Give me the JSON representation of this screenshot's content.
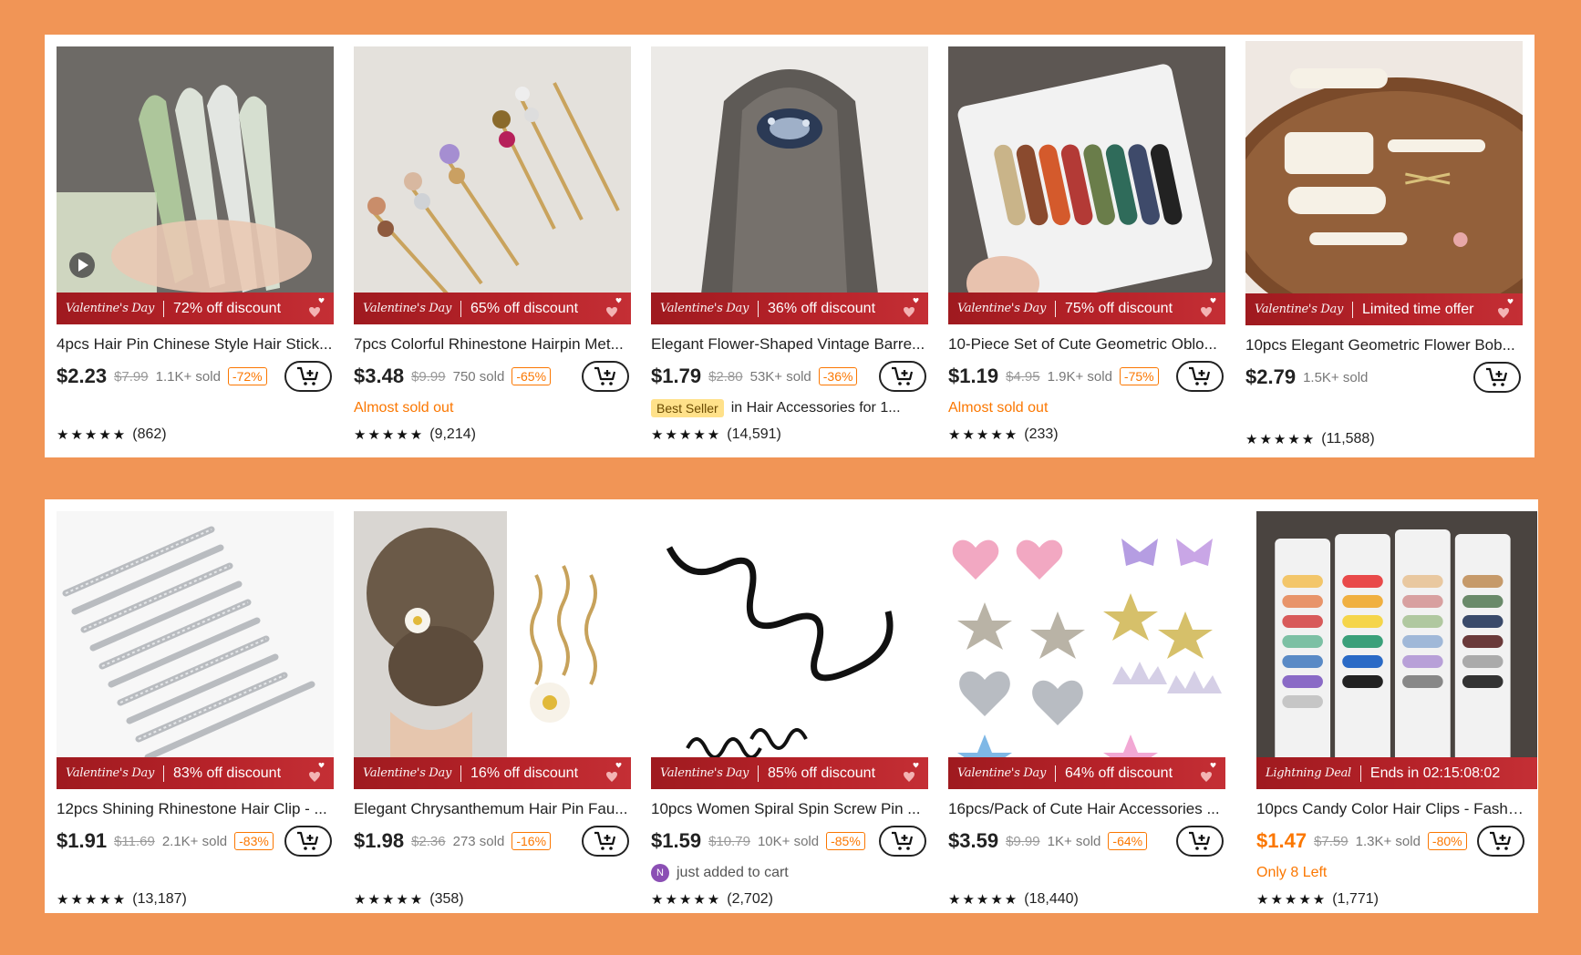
{
  "banner_brand": "Valentine's Day",
  "rows": [
    [
      {
        "title": "4pcs Hair Pin Chinese Style Hair Stick...",
        "deal": "72% off discount",
        "price": "$2.23",
        "orig": "$7.99",
        "sold": "1.1K+ sold",
        "disc": "-72%",
        "extra": "",
        "reviews": "(862)",
        "stars": "★★★★★"
      },
      {
        "title": "7pcs Colorful Rhinestone Hairpin Met...",
        "deal": "65% off discount",
        "price": "$3.48",
        "orig": "$9.99",
        "sold": "750 sold",
        "disc": "-65%",
        "extra": "Almost sold out",
        "reviews": "(9,214)",
        "stars": "★★★★★"
      },
      {
        "title": "Elegant Flower-Shaped Vintage Barre...",
        "deal": "36% off discount",
        "price": "$1.79",
        "orig": "$2.80",
        "sold": "53K+ sold",
        "disc": "-36%",
        "badge": "Best Seller",
        "extra": "in Hair Accessories for 1...",
        "reviews": "(14,591)",
        "stars": "★★★★★"
      },
      {
        "title": "10-Piece Set of Cute Geometric Oblo...",
        "deal": "75% off discount",
        "price": "$1.19",
        "orig": "$4.95",
        "sold": "1.9K+ sold",
        "disc": "-75%",
        "extra": "Almost sold out",
        "reviews": "(233)",
        "stars": "★★★★★"
      },
      {
        "title": "10pcs Elegant Geometric Flower Bob...",
        "deal": "Limited time offer",
        "price": "$2.79",
        "orig": "",
        "sold": "1.5K+ sold",
        "disc": "",
        "extra": "",
        "reviews": "(11,588)",
        "stars": "★★★★★"
      }
    ],
    [
      {
        "title": "12pcs Shining Rhinestone Hair Clip - ...",
        "deal": "83% off discount",
        "price": "$1.91",
        "orig": "$11.69",
        "sold": "2.1K+ sold",
        "disc": "-83%",
        "extra": "",
        "reviews": "(13,187)",
        "stars": "★★★★★"
      },
      {
        "title": "Elegant Chrysanthemum Hair Pin Fau...",
        "deal": "16% off discount",
        "price": "$1.98",
        "orig": "$2.36",
        "sold": "273 sold",
        "disc": "-16%",
        "extra": "",
        "reviews": "(358)",
        "stars": "★★★★★"
      },
      {
        "title": "10pcs Women Spiral Spin Screw Pin ...",
        "deal": "85% off discount",
        "price": "$1.59",
        "orig": "$10.79",
        "sold": "10K+ sold",
        "disc": "-85%",
        "avatar": "N",
        "extra": "just added to cart",
        "reviews": "(2,702)",
        "stars": "★★★★★"
      },
      {
        "title": "16pcs/Pack of Cute Hair Accessories ...",
        "deal": "64% off discount",
        "price": "$3.59",
        "orig": "$9.99",
        "sold": "1K+ sold",
        "disc": "-64%",
        "extra": "",
        "reviews": "(18,440)",
        "stars": "★★★★★"
      },
      {
        "title": "10pcs Candy Color Hair Clips - Fashio...",
        "deal": "Ends in 02:15:08:02",
        "deal_brand": "Lightning Deal",
        "price": "$1.47",
        "orig": "$7.59",
        "sold": "1.3K+ sold",
        "disc": "-80%",
        "extra": "Only 8 Left",
        "reviews": "(1,771)",
        "stars": "★★★★★"
      }
    ]
  ],
  "colors": {
    "accent": "#fb7701",
    "banner": "#b8232a",
    "background": "#F19556"
  }
}
